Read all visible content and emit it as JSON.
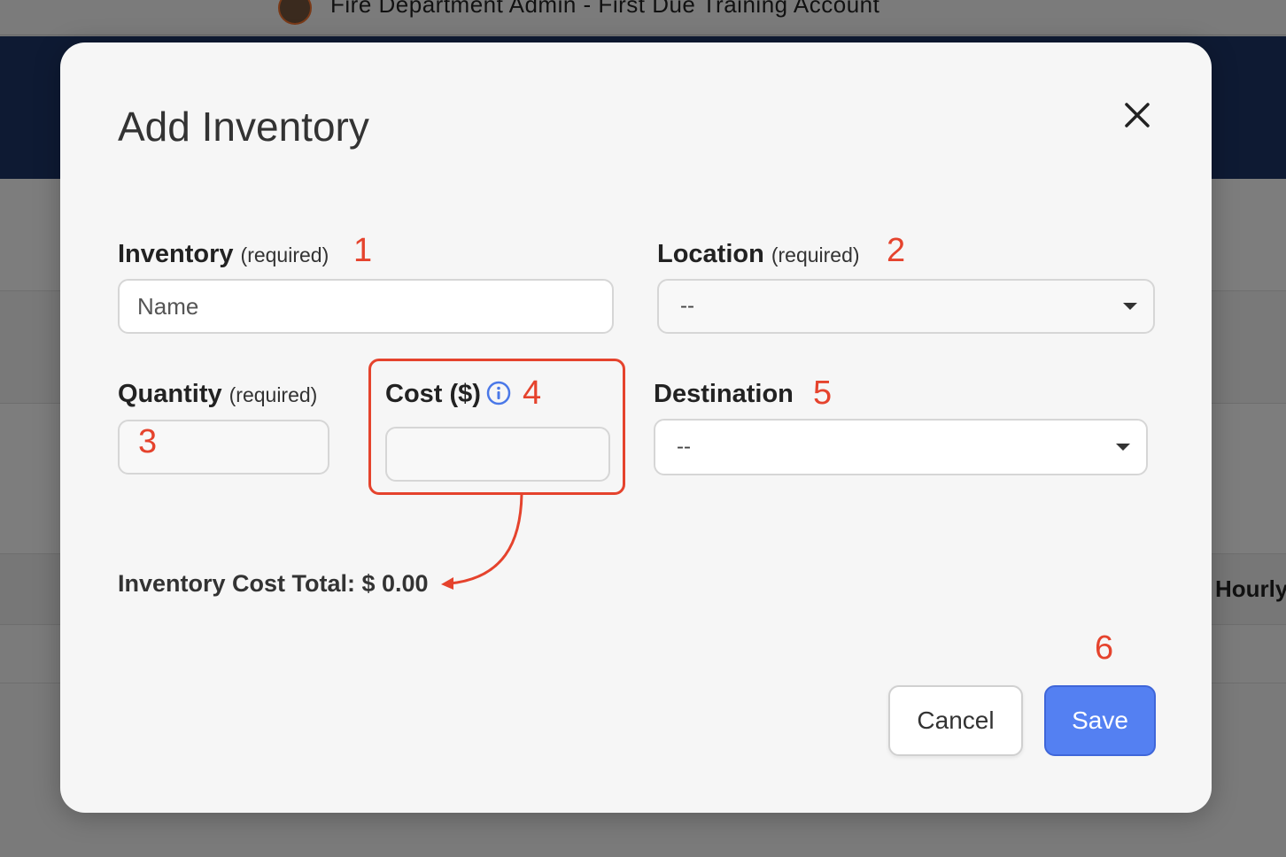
{
  "background_app": {
    "title": "Fire Department Admin - First Due Training Account",
    "column_label": "Hourly"
  },
  "modal": {
    "title": "Add Inventory",
    "inventory": {
      "label": "Inventory",
      "req": "(required)",
      "placeholder": "Name",
      "value": ""
    },
    "location": {
      "label": "Location",
      "req": "(required)",
      "selected": "--"
    },
    "quantity": {
      "label": "Quantity",
      "req": "(required)",
      "value": ""
    },
    "cost": {
      "label": "Cost ($)",
      "value": ""
    },
    "destination": {
      "label": "Destination",
      "selected": "--"
    },
    "total": "Inventory Cost Total: $ 0.00",
    "cancel_label": "Cancel",
    "save_label": "Save"
  },
  "annotations": {
    "n1": "1",
    "n2": "2",
    "n3": "3",
    "n4": "4",
    "n5": "5",
    "n6": "6"
  },
  "colors": {
    "accent": "#5480f2",
    "annotation": "#e5432d",
    "nav": "#0e1a33"
  },
  "icons": {
    "close": "close-icon",
    "info": "info-icon",
    "caret": "chevron-down-icon",
    "logo": "fire-department-logo"
  }
}
